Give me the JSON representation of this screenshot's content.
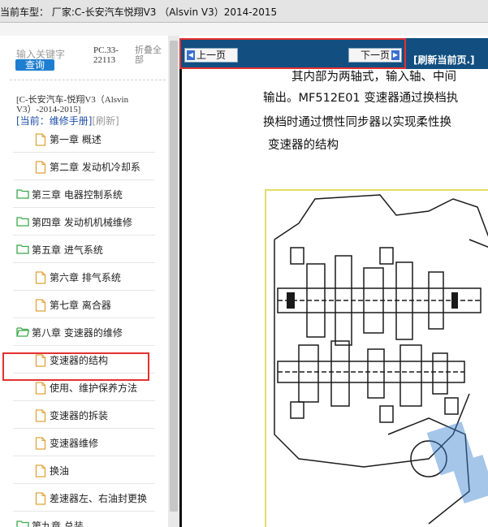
{
  "window": {
    "title": "当前车型：  厂家:C-长安汽车悦翔V3 （Alsvin V3）2014-2015"
  },
  "sidebar": {
    "search_placeholder": "输入关键字",
    "search_button": "查询",
    "model_code": "PC.33-\n22113",
    "collapse_label": "折叠全部",
    "manual_title": "[C-长安汽车-悦翔V3（Alsvin V3）-2014-2015]",
    "current_label": "[当前：",
    "current_link": "维修手册]",
    "refresh_link": "[刷新]",
    "items": [
      {
        "label": "第一章 概述",
        "level": 2,
        "icon": "document-icon"
      },
      {
        "label": "第二章 发动机冷却系",
        "level": 2,
        "icon": "document-icon"
      },
      {
        "label": "第三章 电器控制系统",
        "level": 1,
        "icon": "folder-icon"
      },
      {
        "label": "第四章 发动机机械维修",
        "level": 1,
        "icon": "folder-icon"
      },
      {
        "label": "第五章 进气系统",
        "level": 1,
        "icon": "folder-icon"
      },
      {
        "label": "第六章 排气系统",
        "level": 2,
        "icon": "document-icon"
      },
      {
        "label": "第七章 离合器",
        "level": 2,
        "icon": "document-icon"
      },
      {
        "label": "第八章 变速器的维修",
        "level": 1,
        "icon": "open-folder-icon",
        "selected": true
      },
      {
        "label": "变速器的结构",
        "level": 2,
        "icon": "document-icon"
      },
      {
        "label": "使用、维护保养方法",
        "level": 2,
        "icon": "document-icon"
      },
      {
        "label": "变速器的拆装",
        "level": 2,
        "icon": "document-icon"
      },
      {
        "label": "变速器维修",
        "level": 2,
        "icon": "document-icon"
      },
      {
        "label": "换油",
        "level": 2,
        "icon": "document-icon"
      },
      {
        "label": "差速器左、右油封更换",
        "level": 2,
        "icon": "document-icon"
      },
      {
        "label": "第九章 总装",
        "level": 1,
        "icon": "folder-icon"
      }
    ]
  },
  "toolbar": {
    "prev_label": "上一页",
    "next_label": "下一页",
    "refresh_label": "[刷新当前页.]"
  },
  "document": {
    "lines": [
      "其内部为两轴式，输入轴、中间",
      "输出。MF512E01 变速器通过换档执",
      "换档时通过惯性同步器以实现柔性换",
      "变速器的结构"
    ]
  },
  "colors": {
    "navbar": "#124f80",
    "highlight": "#e53030",
    "button_blue": "#1e7fd0"
  }
}
